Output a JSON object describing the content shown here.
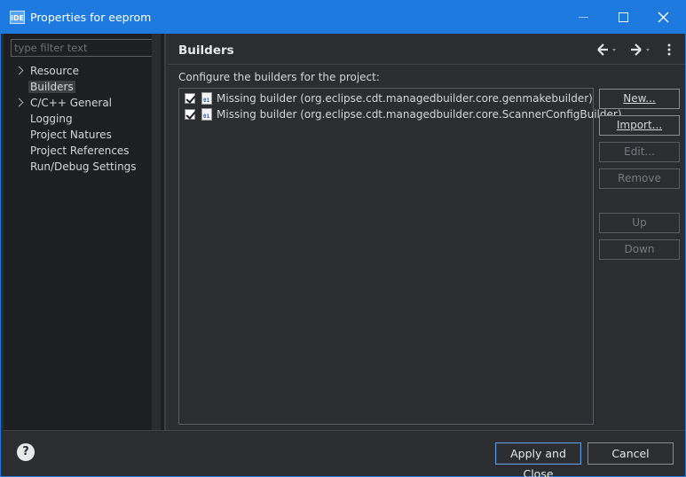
{
  "window": {
    "icon_text": "IDE",
    "title": "Properties for eeprom"
  },
  "sidebar": {
    "filter_placeholder": "type filter text",
    "items": [
      {
        "label": "Resource",
        "expandable": true,
        "selected": false
      },
      {
        "label": "Builders",
        "expandable": false,
        "selected": true
      },
      {
        "label": "C/C++ General",
        "expandable": true,
        "selected": false
      },
      {
        "label": "Logging",
        "expandable": false,
        "selected": false
      },
      {
        "label": "Project Natures",
        "expandable": false,
        "selected": false
      },
      {
        "label": "Project References",
        "expandable": false,
        "selected": false
      },
      {
        "label": "Run/Debug Settings",
        "expandable": false,
        "selected": false
      }
    ]
  },
  "main": {
    "title": "Builders",
    "description": "Configure the builders for the project:",
    "builders": [
      {
        "checked": true,
        "icon_text": "01",
        "label": "Missing builder (org.eclipse.cdt.managedbuilder.core.genmakebuilder)"
      },
      {
        "checked": true,
        "icon_text": "01",
        "label": "Missing builder (org.eclipse.cdt.managedbuilder.core.ScannerConfigBuilder)"
      }
    ],
    "buttons": {
      "new": "New...",
      "import": "Import...",
      "edit": "Edit...",
      "remove": "Remove",
      "up": "Up",
      "down": "Down"
    }
  },
  "footer": {
    "help_symbol": "?",
    "apply_close": "Apply and Close",
    "cancel": "Cancel"
  },
  "colors": {
    "titlebar": "#1f7ae0",
    "background": "#2b2d30",
    "sidebar_bg": "#1e1f22",
    "text": "#d6d6d6"
  }
}
